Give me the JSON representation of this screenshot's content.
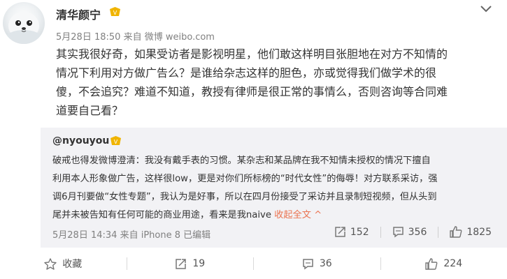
{
  "post": {
    "author": "清华颜宁",
    "time": "5月28日 18:50",
    "source_prefix": "来自",
    "source": "微博 weibo.com",
    "text_lines": [
      "其实我很好奇，如果受访者是影视明星，他们敢这样明目张胆地在对方不知情的",
      "情况下利用对方做广告么？是谁给杂志这样的胆色，亦或觉得我们做学术的很",
      "傻，不会追究？难道不知道，教授有律师是很正常的事情么，否则咨询等合同难",
      "道要自己看？"
    ]
  },
  "repost": {
    "author": "@nyouyou",
    "text_lines": [
      "破戒也得发微博澄清：我没有戴手表的习惯。某杂志和某品牌在我不知情未授权的情况下擅自",
      "利用本人形象做广告，这样很low，更是对你们所标榜的“时代女性”的侮辱！对方联系采访，强",
      "调6月刊要做“女性专题”，我认为是好事，所以在四月份接受了采访并且录制短视频，但从头到"
    ],
    "last_line": "尾并未被告知有任何可能的商业用途，看来是我naive ",
    "collapse_label": "收起全文 ^",
    "time": "5月28日 14:34",
    "source_prefix": "来自",
    "source": "iPhone 8",
    "edited": "已编辑",
    "repost_count": "152",
    "comment_count": "356",
    "like_count": "1825"
  },
  "footer": {
    "favorite_label": "收藏",
    "repost_count": "19",
    "comment_count": "36",
    "like_count": "224"
  },
  "colors": {
    "accent": "#eb7350",
    "repost_bg": "#f2f2f5",
    "meta": "#808080",
    "badge": "#f0b400"
  },
  "icons": [
    "avatar-seal",
    "vip-badge-icon",
    "chevron-down-icon",
    "repost-icon",
    "comment-icon",
    "like-icon",
    "star-icon"
  ]
}
